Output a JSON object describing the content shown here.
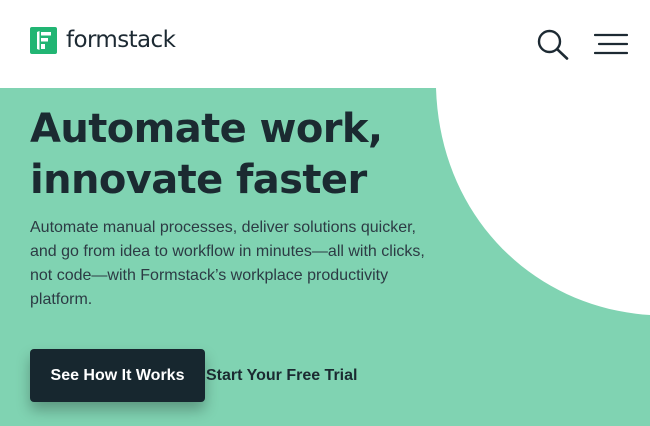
{
  "header": {
    "logo_text": "formstack",
    "logo_icon": "formstack-logo-icon",
    "search_icon": "search-icon",
    "menu_icon": "hamburger-menu-icon"
  },
  "hero": {
    "headline_line1": "Automate work,",
    "headline_line2": "innovate faster",
    "description": "Automate manual processes, deliver solutions quicker, and go from idea to workflow in minutes—all with clicks, not code—with Formstack’s workplace productivity platform.",
    "primary_cta": "See How It Works",
    "secondary_cta": "Start Your Free Trial"
  },
  "colors": {
    "brand_green": "#21b573",
    "hero_bg": "#80d3b2",
    "text_dark": "#1b2a31",
    "button_bg": "#17272f"
  }
}
